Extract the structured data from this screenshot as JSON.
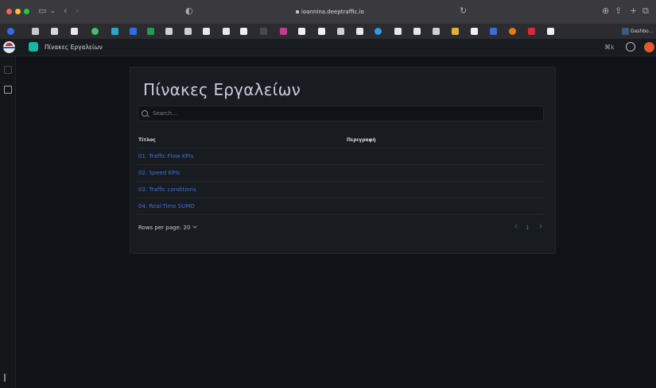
{
  "browser": {
    "url": "ioannina.deeptraffic.io",
    "favorites_last_label": "Dashbo..."
  },
  "app": {
    "breadcrumb": "Πίνακες Εργαλείων",
    "shortcut_label": "⌘k"
  },
  "page": {
    "title": "Πίνακες Εργαλείων",
    "search_placeholder": "Search..."
  },
  "table": {
    "columns": [
      "Τίτλος",
      "Περιγραφή"
    ],
    "rows": [
      {
        "title": "01. Traffic Flow KPIs",
        "description": ""
      },
      {
        "title": "02. Speed KPIs",
        "description": ""
      },
      {
        "title": "03. Traffic conditions",
        "description": ""
      },
      {
        "title": "04. Real-Time SUMO",
        "description": ""
      }
    ]
  },
  "pagination": {
    "rows_per_page_label": "Rows per page:",
    "rows_per_page_value": "20",
    "current_page": "1"
  },
  "colors": {
    "link": "#3d71d9",
    "background": "#111217",
    "panel": "#181b1f",
    "brand_badge": "#14b8a6",
    "avatar": "#e05a2b"
  },
  "icons": [
    "apple-close",
    "sidebar-toggle-icon",
    "back-icon",
    "forward-icon",
    "shield-icon",
    "lock-icon",
    "reload-icon",
    "download-icon",
    "share-icon",
    "plus-icon",
    "tabs-icon",
    "search-icon",
    "dashboard-icon",
    "expand-icon",
    "help-icon"
  ]
}
